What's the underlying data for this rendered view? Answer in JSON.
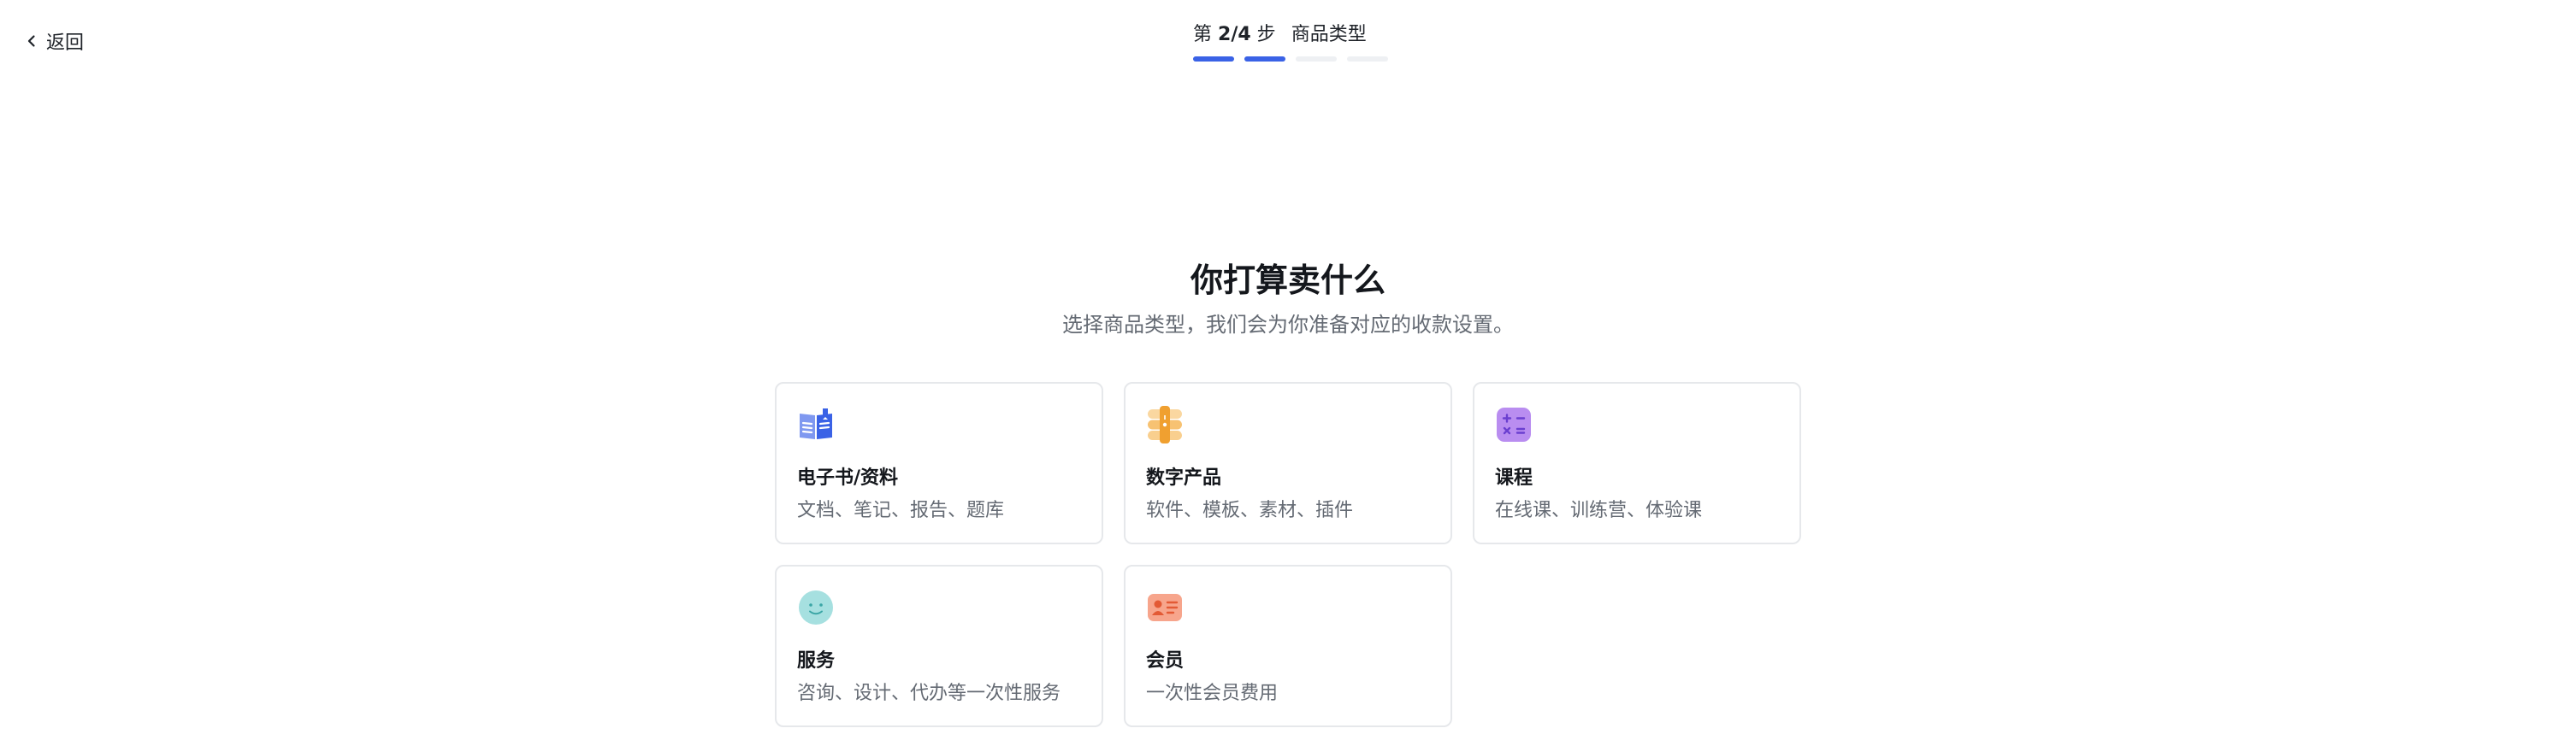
{
  "header": {
    "back_label": "返回",
    "step_prefix": "第",
    "step_count": "2/4",
    "step_suffix": "步",
    "step_name": "商品类型",
    "progress": {
      "current_step": 2,
      "total_steps": 4
    },
    "accent_color": "#3a62e6"
  },
  "main": {
    "title": "你打算卖什么",
    "subtitle": "选择商品类型，我们会为你准备对应的收款设置。",
    "options": [
      {
        "title": "电子书/资料",
        "desc": "文档、笔记、报告、题库",
        "icon": "ebook-icon"
      },
      {
        "title": "数字产品",
        "desc": "软件、模板、素材、插件",
        "icon": "digital-product-icon"
      },
      {
        "title": "课程",
        "desc": "在线课、训练营、体验课",
        "icon": "course-icon"
      },
      {
        "title": "服务",
        "desc": "咨询、设计、代办等一次性服务",
        "icon": "service-icon"
      },
      {
        "title": "会员",
        "desc": "一次性会员费用",
        "icon": "membership-icon"
      }
    ]
  }
}
